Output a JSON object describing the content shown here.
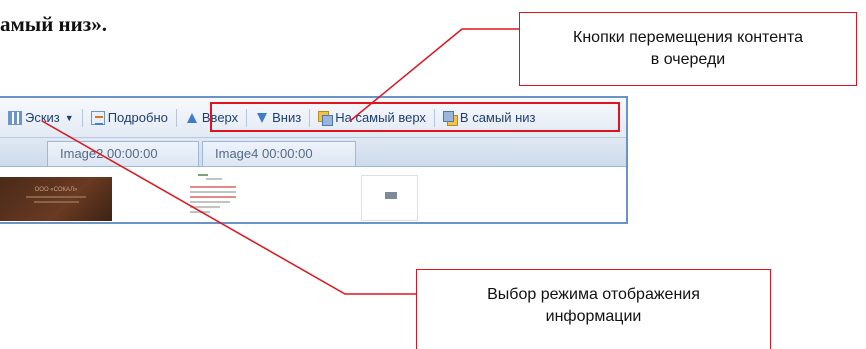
{
  "heading": {
    "text": "амый низ»."
  },
  "callouts": {
    "top_lines": [
      "Кнопки перемещения контента",
      "в очереди"
    ],
    "bottom_lines": [
      "Выбор режима отображения",
      "информации"
    ]
  },
  "toolbar": {
    "sketch_label": "Эскиз",
    "details_label": "Подробно",
    "up_label": "Вверх",
    "down_label": "Вниз",
    "to_top_label": "На самый верх",
    "to_bottom_label": "В самый низ"
  },
  "tabs": [
    {
      "label": "Image2 00:00:00"
    },
    {
      "label": "Image4 00:00:00"
    }
  ],
  "thumbnails": [
    {
      "text": "ООО «СОКАЛ»"
    }
  ],
  "colors": {
    "callout_border": "#e0141c",
    "window_border": "#6a94c8"
  }
}
